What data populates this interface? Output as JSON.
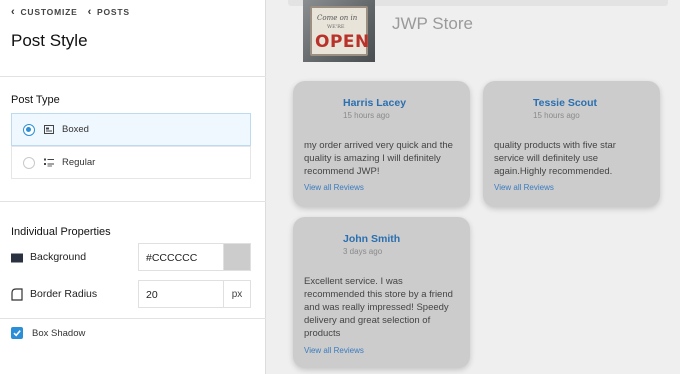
{
  "breadcrumb": {
    "items": [
      "CUSTOMIZE",
      "POSTS"
    ]
  },
  "panel": {
    "title": "Post Style"
  },
  "post_type": {
    "label": "Post Type",
    "options": [
      {
        "label": "Boxed",
        "selected": true,
        "icon": "boxed-layout-icon"
      },
      {
        "label": "Regular",
        "selected": false,
        "icon": "list-layout-icon"
      }
    ]
  },
  "individual_properties": {
    "label": "Individual Properties",
    "background": {
      "label": "Background",
      "value": "#CCCCCC",
      "swatch_color": "#cccccc"
    },
    "border_radius": {
      "label": "Border Radius",
      "value": "20",
      "unit": "px"
    },
    "box_shadow": {
      "label": "Box Shadow",
      "checked": true
    }
  },
  "store": {
    "name": "JWP Store",
    "sign_text_1": "Come on in",
    "sign_text_2": "WE'RE",
    "sign_text_3": "OPEN"
  },
  "reviews": [
    {
      "name": "Harris Lacey",
      "time": "15 hours ago",
      "text": "my order arrived very quick and the quality is amazing I will definitely recommend JWP!",
      "link": "View all Reviews"
    },
    {
      "name": "Tessie Scout",
      "time": "15 hours ago",
      "text": "quality products with five star service will definitely use again.Highly recommended.",
      "link": "View all Reviews"
    },
    {
      "name": "John Smith",
      "time": "3 days ago",
      "text": "Excellent service. I was recommended this store by a friend and was really impressed! Speedy delivery and great selection of products",
      "link": "View all Reviews"
    }
  ],
  "colors": {
    "accent": "#2a8fd6",
    "card_bg": "#cccccc",
    "link": "#2a6fb0"
  }
}
